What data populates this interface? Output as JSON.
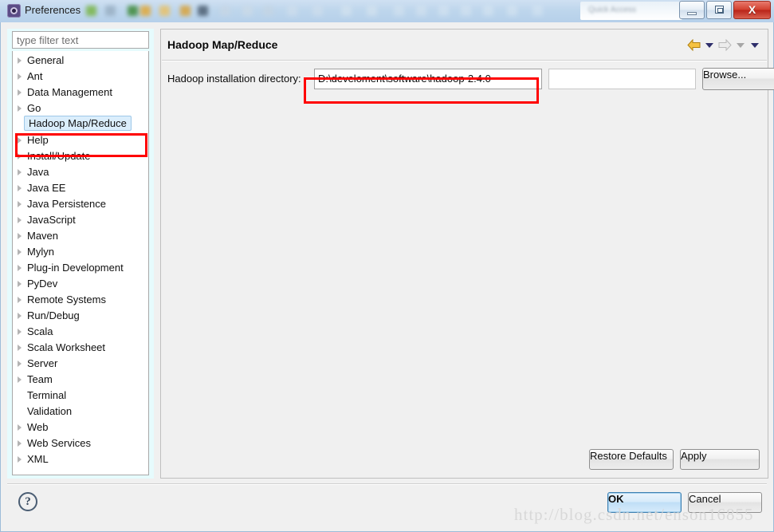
{
  "window": {
    "title": "Preferences",
    "app_icon": "eclipse-icon",
    "quick_access_placeholder": "Quick Access",
    "controls": {
      "minimize": "Minimize",
      "maximize": "Maximize",
      "close": "X"
    }
  },
  "sidebar": {
    "filter_placeholder": "type filter text",
    "items": [
      {
        "label": "General",
        "expandable": true,
        "selected": false
      },
      {
        "label": "Ant",
        "expandable": true,
        "selected": false
      },
      {
        "label": "Data Management",
        "expandable": true,
        "selected": false
      },
      {
        "label": "Go",
        "expandable": true,
        "selected": false
      },
      {
        "label": "Hadoop Map/Reduce",
        "expandable": false,
        "selected": true
      },
      {
        "label": "Help",
        "expandable": true,
        "selected": false
      },
      {
        "label": "Install/Update",
        "expandable": true,
        "selected": false
      },
      {
        "label": "Java",
        "expandable": true,
        "selected": false
      },
      {
        "label": "Java EE",
        "expandable": true,
        "selected": false
      },
      {
        "label": "Java Persistence",
        "expandable": true,
        "selected": false
      },
      {
        "label": "JavaScript",
        "expandable": true,
        "selected": false
      },
      {
        "label": "Maven",
        "expandable": true,
        "selected": false
      },
      {
        "label": "Mylyn",
        "expandable": true,
        "selected": false
      },
      {
        "label": "Plug-in Development",
        "expandable": true,
        "selected": false
      },
      {
        "label": "PyDev",
        "expandable": true,
        "selected": false
      },
      {
        "label": "Remote Systems",
        "expandable": true,
        "selected": false
      },
      {
        "label": "Run/Debug",
        "expandable": true,
        "selected": false
      },
      {
        "label": "Scala",
        "expandable": true,
        "selected": false
      },
      {
        "label": "Scala Worksheet",
        "expandable": true,
        "selected": false
      },
      {
        "label": "Server",
        "expandable": true,
        "selected": false
      },
      {
        "label": "Team",
        "expandable": true,
        "selected": false
      },
      {
        "label": "Terminal",
        "expandable": false,
        "selected": false
      },
      {
        "label": "Validation",
        "expandable": false,
        "selected": false
      },
      {
        "label": "Web",
        "expandable": true,
        "selected": false
      },
      {
        "label": "Web Services",
        "expandable": true,
        "selected": false
      },
      {
        "label": "XML",
        "expandable": true,
        "selected": false
      }
    ]
  },
  "page": {
    "title": "Hadoop Map/Reduce",
    "nav": {
      "back_icon": "back-arrow-icon",
      "back_menu_icon": "chevron-down-icon",
      "forward_icon": "forward-arrow-icon",
      "forward_menu_icon": "chevron-down-icon",
      "more_menu_icon": "chevron-down-icon"
    },
    "field": {
      "label": "Hadoop installation directory:",
      "value": "D:\\develoment\\software\\hadoop-2.4.0",
      "secondary_value": ""
    },
    "browse_label": "Browse...",
    "restore_defaults_label": "Restore Defaults",
    "apply_label": "Apply"
  },
  "footer": {
    "help_icon": "help-question-icon",
    "ok_label": "OK",
    "cancel_label": "Cancel"
  },
  "watermark": "http://blog.csdn.net/enson16855",
  "annotations": {
    "accent_color": "#ff0000",
    "tree_highlight": "Hadoop Map/Reduce",
    "input_highlight": "Hadoop installation directory input"
  }
}
